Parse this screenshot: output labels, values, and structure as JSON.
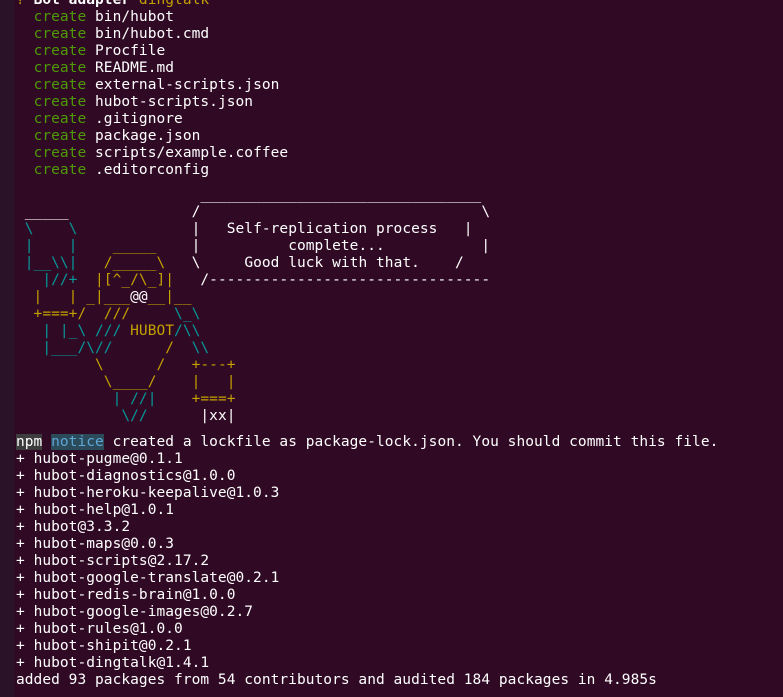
{
  "terminal": {
    "background": "#300a24",
    "prompt_cut": {
      "question_mark": "?",
      "label": "Bot adapter",
      "value": "dingtalk"
    },
    "create_word": "create",
    "created_files": [
      "bin/hubot",
      "bin/hubot.cmd",
      "Procfile",
      "README.md",
      "external-scripts.json",
      "hubot-scripts.json",
      ".gitignore",
      "package.json",
      "scripts/example.coffee",
      ".editorconfig"
    ],
    "ascii_art": {
      "bubble_top": "________________________________",
      "bubble_line1": "Self-replication process",
      "bubble_line2": "complete...",
      "bubble_line3": "Good luck with that.",
      "bubble_bottom": "/--------------------------------",
      "robot_label": "HUBOT",
      "box_label": "xx"
    },
    "notice": {
      "npm": "npm",
      "level": "notice",
      "message": "created a lockfile as package-lock.json. You should commit this file."
    },
    "installed_packages": [
      "hubot-pugme@0.1.1",
      "hubot-diagnostics@1.0.0",
      "hubot-heroku-keepalive@1.0.3",
      "hubot-help@1.0.1",
      "hubot@3.3.2",
      "hubot-maps@0.0.3",
      "hubot-scripts@2.17.2",
      "hubot-google-translate@0.2.1",
      "hubot-redis-brain@1.0.0",
      "hubot-google-images@0.2.7",
      "hubot-rules@1.0.0",
      "hubot-shipit@0.2.1",
      "hubot-dingtalk@1.4.1"
    ],
    "summary": "added 93 packages from 54 contributors and audited 184 packages in 4.985s"
  }
}
